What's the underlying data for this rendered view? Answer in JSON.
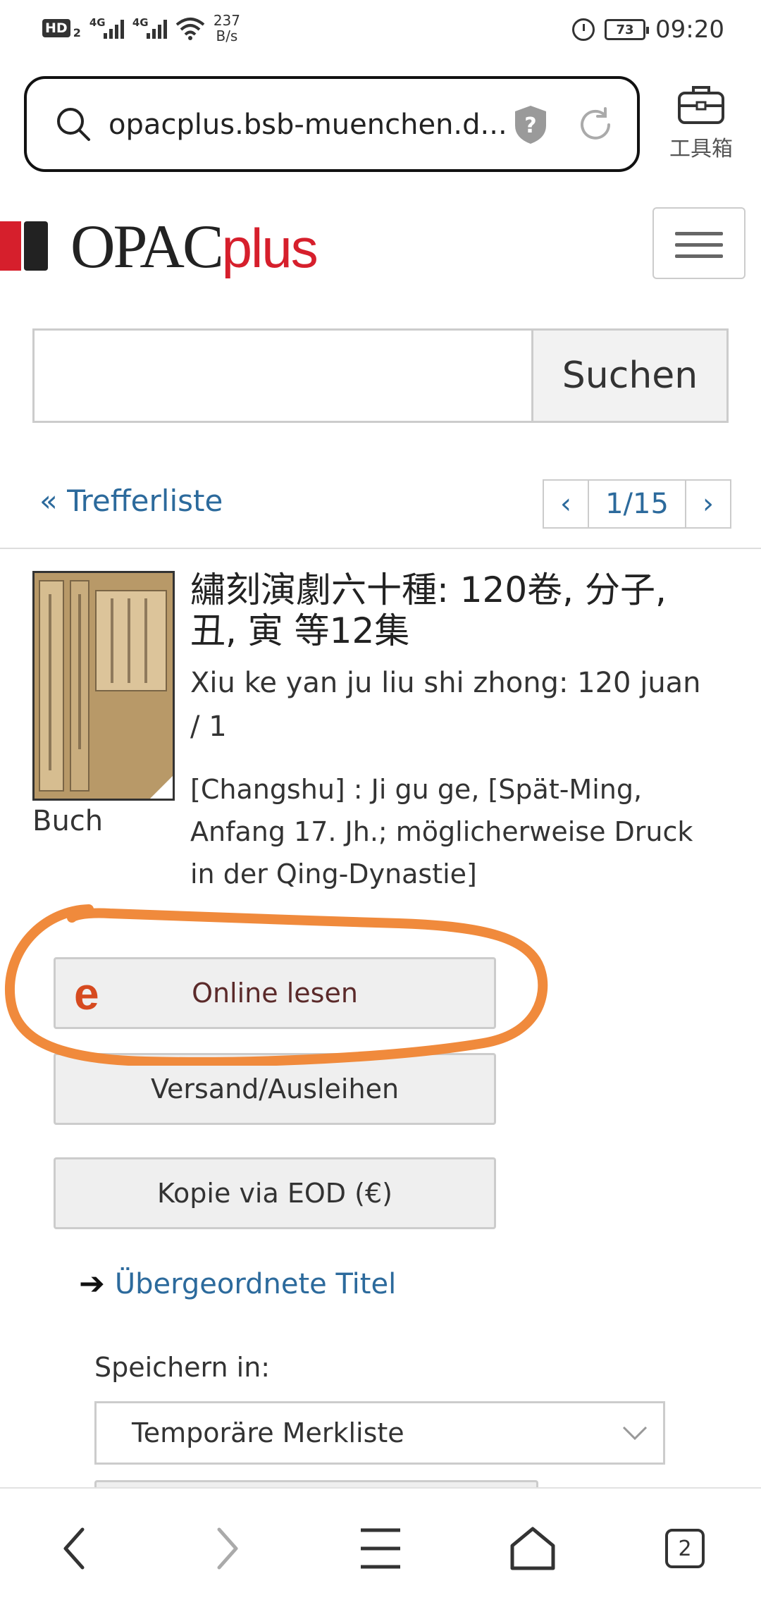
{
  "status_bar": {
    "hd_label": "HD",
    "hd_sub": "2",
    "signal1_tag": "4G",
    "signal2_tag": "4G",
    "net_speed_value": "237",
    "net_speed_unit": "B/s",
    "battery": "73",
    "time": "09:20"
  },
  "browser": {
    "url": "opacplus.bsb-muenchen.d...",
    "toolbox_label": "工具箱",
    "open_tabs": "2"
  },
  "site": {
    "logo_main": "OPAC",
    "logo_plus": "plus",
    "brand_red": "#d61f2c"
  },
  "search": {
    "input_value": "",
    "button_label": "Suchen"
  },
  "result_nav": {
    "back_icon": "«",
    "back_label": "Trefferliste",
    "prev": "‹",
    "position": "1/15",
    "next": "›"
  },
  "record": {
    "media_type": "Buch",
    "title": "繡刻演劇六十種: 120卷, 分子, 丑, 寅 等12集",
    "subtitle": "Xiu ke yan ju liu shi zhong: 120 juan / 1",
    "imprint": "[Changshu] : Ji gu ge, [Spät-Ming, Anfang 17. Jh.; möglicherweise Druck in der Qing-Dynastie]"
  },
  "actions": {
    "online_icon": "e",
    "online": "Online lesen",
    "versand": "Versand/Ausleihen",
    "kopie": "Kopie via EOD (€)",
    "parent_arrow": "➔",
    "parent_titles": "Übergeordnete Titel"
  },
  "save": {
    "label": "Speichern in:",
    "selected": "Temporäre Merkliste"
  },
  "colors": {
    "link": "#2c6a9c",
    "annotation": "#f08a3c"
  }
}
